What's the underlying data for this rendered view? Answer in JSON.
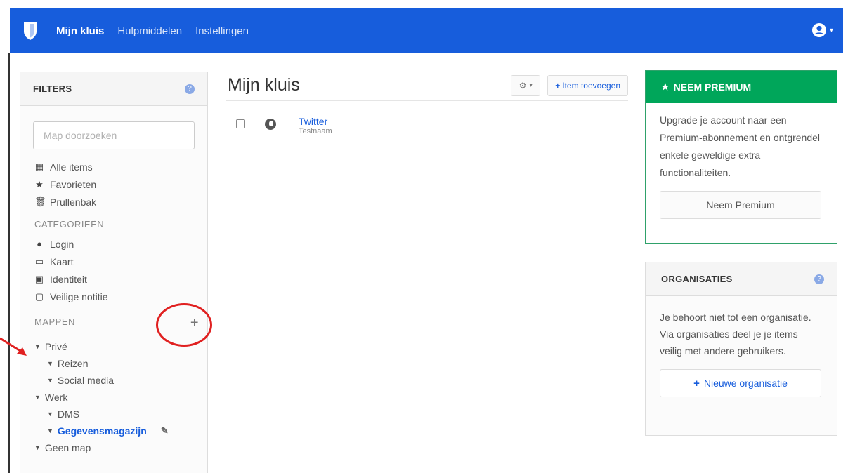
{
  "nav": {
    "links": [
      "Mijn kluis",
      "Hulpmiddelen",
      "Instellingen"
    ]
  },
  "filters": {
    "title": "FILTERS",
    "search_placeholder": "Map doorzoeken",
    "items": [
      "Alle items",
      "Favorieten",
      "Prullenbak"
    ],
    "categories_title": "CATEGORIEËN",
    "categories": [
      "Login",
      "Kaart",
      "Identiteit",
      "Veilige notitie"
    ],
    "folders_title": "MAPPEN",
    "folders": {
      "prive": "Privé",
      "reizen": "Reizen",
      "social": "Social media",
      "werk": "Werk",
      "dms": "DMS",
      "gegevens": "Gegevensmagazijn",
      "geen": "Geen map"
    }
  },
  "main": {
    "title": "Mijn kluis",
    "add_label": "Item toevoegen",
    "items": [
      {
        "name": "Twitter",
        "subtitle": "Testnaam"
      }
    ]
  },
  "premium": {
    "title": "NEEM PREMIUM",
    "body": "Upgrade je account naar een Premium-abonnement en ontgrendel enkele geweldige extra functionaliteiten.",
    "button": "Neem Premium"
  },
  "orgs": {
    "title": "ORGANISATIES",
    "body": "Je behoort niet tot een organisatie. Via organisaties deel je je items veilig met andere gebruikers.",
    "button": "Nieuwe organisatie"
  },
  "colors": {
    "brand": "#175ddc",
    "premium": "#00a65a",
    "annotation": "#e02020"
  }
}
